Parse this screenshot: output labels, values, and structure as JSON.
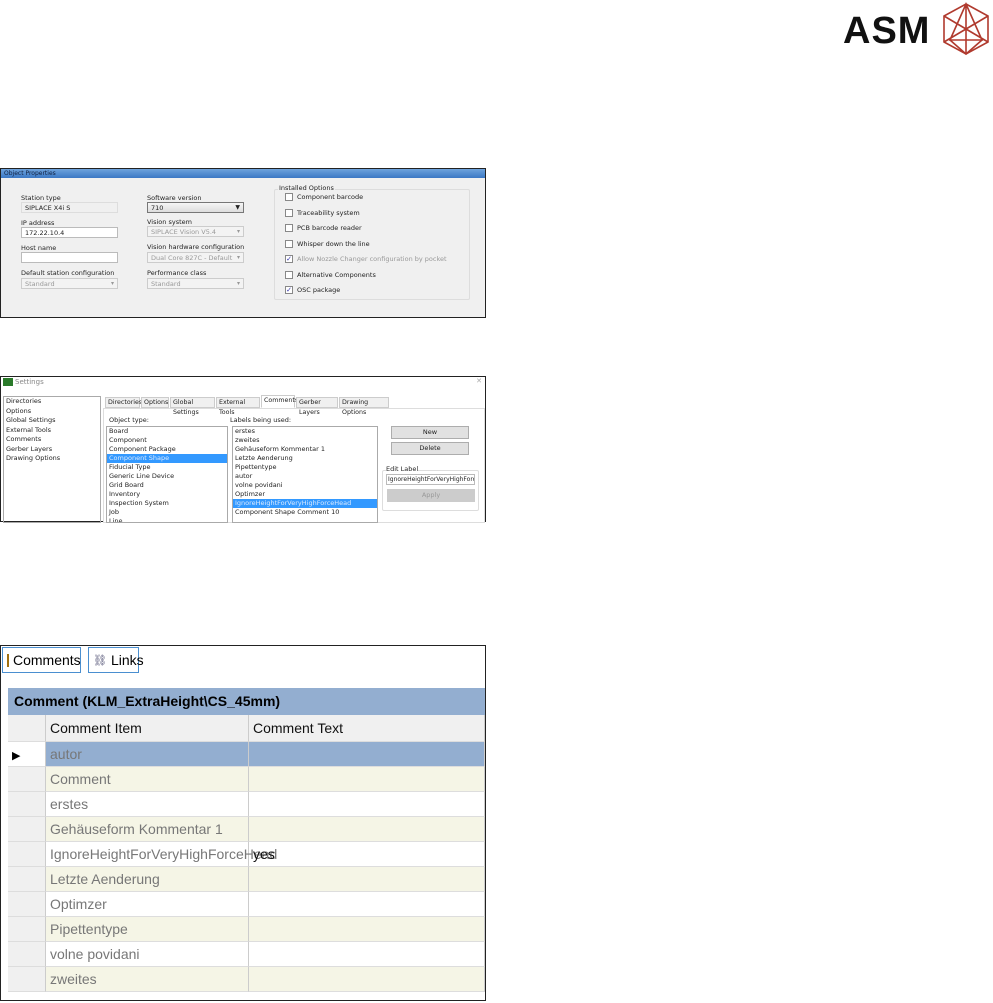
{
  "logo": {
    "text": "ASM"
  },
  "object_properties": {
    "title": "Object Properties",
    "station_type_label": "Station type",
    "station_type": "SIPLACE X4i S",
    "ip_label": "IP address",
    "ip": "172.22.10.4",
    "host_label": "Host name",
    "host": "",
    "default_config_label": "Default station configuration",
    "default_config": "Standard",
    "software_label": "Software version",
    "software": "710",
    "vision_label": "Vision system",
    "vision": "SIPLACE Vision V5.4",
    "vision_hw_label": "Vision hardware configuration",
    "vision_hw": "Dual Core 827C - Default",
    "perf_label": "Performance class",
    "perf": "Standard",
    "options_label": "Installed Options",
    "options": [
      {
        "label": "Component barcode",
        "checked": false
      },
      {
        "label": "Traceability system",
        "checked": false
      },
      {
        "label": "PCB barcode reader",
        "checked": false
      },
      {
        "label": "Whisper down the line",
        "checked": false
      },
      {
        "label": "Allow Nozzle Changer configuration by pocket",
        "checked": true
      },
      {
        "label": "Alternative Components",
        "checked": false
      },
      {
        "label": "OSC package",
        "checked": true
      }
    ]
  },
  "settings": {
    "title": "Settings",
    "close": "✕",
    "nav": [
      "Directories",
      "Options",
      "Global Settings",
      "External Tools",
      "Comments",
      "Gerber Layers",
      "Drawing Options"
    ],
    "tabs": [
      "Directories",
      "Options",
      "Global Settings",
      "External Tools",
      "Comments",
      "Gerber Layers",
      "Drawing Options"
    ],
    "object_type_label": "Object type:",
    "object_types": [
      "Board",
      "Component",
      "Component Package",
      "Component Shape",
      "Fiducial Type",
      "Generic Line Device",
      "Grid Board",
      "Inventory",
      "Inspection System",
      "Job",
      "Line"
    ],
    "labels_label": "Labels being used:",
    "labels": [
      "erstes",
      "zweites",
      "Gehäuseform Kommentar 1",
      "Letzte Aenderung",
      "Pipettentype",
      "autor",
      "volne povidani",
      "Optimzer",
      "IgnoreHeightForVeryHighForceHead",
      "Component Shape Comment 10"
    ],
    "new": "New",
    "delete": "Delete",
    "edit_label": "Edit Label",
    "edit_value": "IgnoreHeightForVeryHighForce",
    "apply": "Apply"
  },
  "comments": {
    "tabs": [
      "Comments",
      "Links"
    ],
    "title": "Comment (KLM_ExtraHeight\\CS_45mm)",
    "columns": [
      "Comment Item",
      "Comment Text"
    ],
    "rows": [
      {
        "item": "autor",
        "text": ""
      },
      {
        "item": "Comment",
        "text": ""
      },
      {
        "item": "erstes",
        "text": ""
      },
      {
        "item": "Gehäuseform Kommentar 1",
        "text": ""
      },
      {
        "item": "IgnoreHeightForVeryHighForceHead",
        "text": "yes"
      },
      {
        "item": "Letzte Aenderung",
        "text": ""
      },
      {
        "item": "Optimzer",
        "text": ""
      },
      {
        "item": "Pipettentype",
        "text": ""
      },
      {
        "item": "volne povidani",
        "text": ""
      },
      {
        "item": "zweites",
        "text": ""
      }
    ]
  }
}
